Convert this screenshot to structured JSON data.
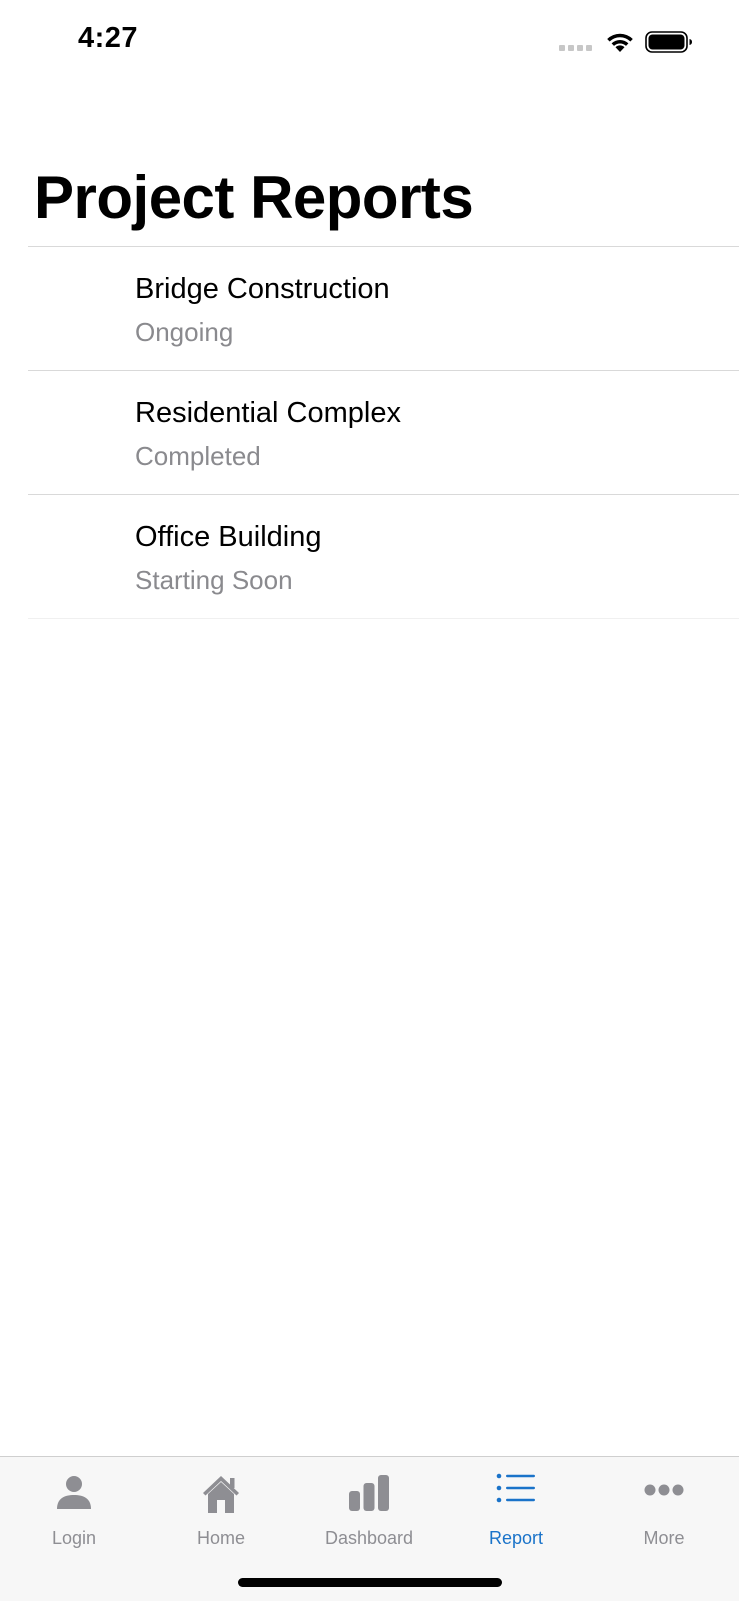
{
  "status_bar": {
    "time": "4:27",
    "icons": [
      "signal-icon",
      "wifi-icon",
      "battery-icon"
    ]
  },
  "page": {
    "title": "Project Reports"
  },
  "reports": [
    {
      "name": "Bridge Construction",
      "status": "Ongoing"
    },
    {
      "name": "Residential Complex",
      "status": "Completed"
    },
    {
      "name": "Office Building",
      "status": "Starting Soon"
    }
  ],
  "tab_bar": {
    "active_tab": "Report",
    "tabs": [
      {
        "label": "Login",
        "icon": "person-icon"
      },
      {
        "label": "Home",
        "icon": "house-icon"
      },
      {
        "label": "Dashboard",
        "icon": "bar-chart-icon"
      },
      {
        "label": "Report",
        "icon": "list-icon"
      },
      {
        "label": "More",
        "icon": "ellipsis-icon"
      }
    ]
  },
  "colors": {
    "accent": "#1a73c9",
    "inactive": "#8e8e93",
    "secondary_text": "#8a8a8e",
    "tab_bar_bg": "#f7f7f7"
  }
}
